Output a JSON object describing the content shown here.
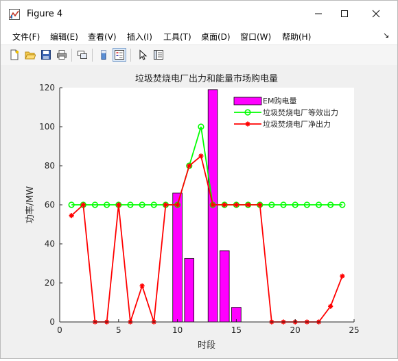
{
  "window": {
    "title": "Figure 4",
    "minimize_glyph": "—",
    "maximize_glyph": "☐",
    "close_glyph": "✕"
  },
  "menu": {
    "items": [
      "文件(F)",
      "编辑(E)",
      "查看(V)",
      "插入(I)",
      "工具(T)",
      "桌面(D)",
      "窗口(W)",
      "帮助(H)"
    ],
    "dock_glyph": "↘"
  },
  "toolbar": {
    "icons": [
      "new-figure-icon",
      "open-file-icon",
      "save-icon",
      "print-icon",
      "link-plot-icon",
      "colorbar-icon",
      "legend-icon",
      "pointer-icon",
      "property-inspector-icon"
    ]
  },
  "colors": {
    "bar_fill": "#ff00ff",
    "equivalent_output": "#00ff00",
    "net_output": "#ff0000"
  },
  "chart_data": {
    "type": "bar",
    "title": "垃圾焚烧电厂出力和能量市场购电量",
    "xlabel": "时段",
    "ylabel": "功率/MW",
    "xlim": [
      0,
      25
    ],
    "ylim": [
      0,
      120
    ],
    "xticks": [
      "0",
      "5",
      "10",
      "15",
      "20",
      "25"
    ],
    "yticks": [
      "0",
      "20",
      "40",
      "60",
      "80",
      "100",
      "120"
    ],
    "legend_position": "top-right",
    "bars": {
      "name": "EM购电量",
      "x": [
        10,
        11,
        13,
        14,
        15
      ],
      "values": [
        66,
        32.5,
        119,
        36.5,
        7.5
      ]
    },
    "series": [
      {
        "name": "垃圾焚烧电厂等效出力",
        "marker": "circle",
        "x": [
          1,
          2,
          3,
          4,
          5,
          6,
          7,
          8,
          9,
          10,
          11,
          12,
          13,
          14,
          15,
          16,
          17,
          18,
          19,
          20,
          21,
          22,
          23,
          24
        ],
        "values": [
          60,
          60,
          60,
          60,
          60,
          60,
          60,
          60,
          60,
          60,
          80,
          100,
          60,
          60,
          60,
          60,
          60,
          60,
          60,
          60,
          60,
          60,
          60,
          60
        ]
      },
      {
        "name": "垃圾焚烧电厂净出力",
        "marker": "asterisk",
        "x": [
          1,
          2,
          3,
          4,
          5,
          6,
          7,
          8,
          9,
          10,
          11,
          12,
          13,
          14,
          15,
          16,
          17,
          18,
          19,
          20,
          21,
          22,
          23,
          24
        ],
        "values": [
          54.5,
          60,
          0,
          0,
          60,
          0,
          18.5,
          0,
          60,
          60,
          80,
          85,
          60,
          60,
          60,
          60,
          60,
          0,
          0,
          0,
          0,
          0,
          8,
          23.5
        ]
      }
    ]
  }
}
